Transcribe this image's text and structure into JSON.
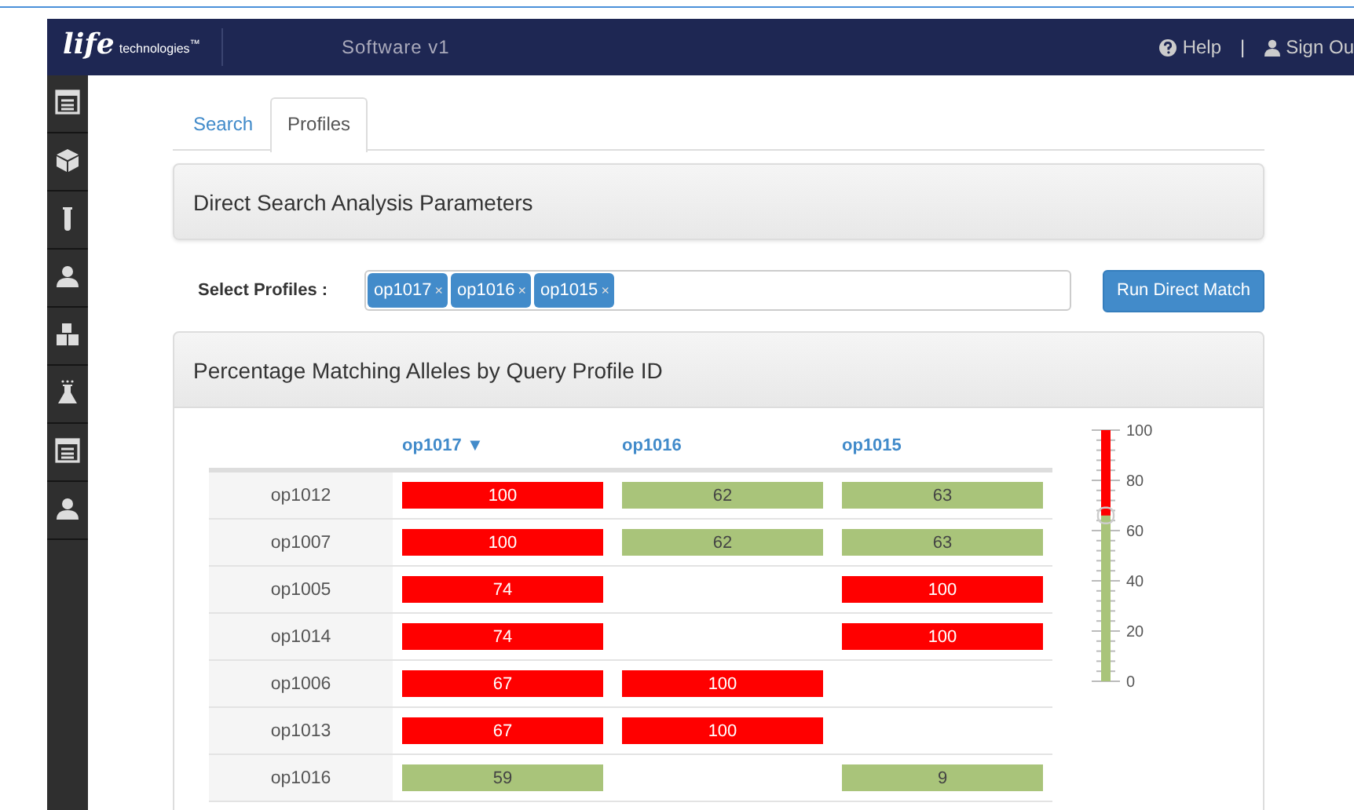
{
  "header": {
    "logo_mark": "life",
    "logo_text": "technologies",
    "logo_tm": "™",
    "title": "Software v1",
    "links": [
      {
        "label": "Help"
      },
      {
        "label": "Sign Ou"
      }
    ],
    "separator": "|"
  },
  "tabs": [
    {
      "label": "Search",
      "selected": false
    },
    {
      "label": "Profiles",
      "selected": true
    }
  ],
  "parameters_panel": {
    "title": "Direct Search Analysis Parameters"
  },
  "select_profiles": {
    "label": "Select Profiles :",
    "tags": [
      {
        "label": "op1017",
        "remove": "×"
      },
      {
        "label": "op1016",
        "remove": "×"
      },
      {
        "label": "op1015",
        "remove": "×"
      }
    ],
    "button": "Run Direct Match"
  },
  "results_panel": {
    "title": "Percentage Matching Alleles by Query Profile ID",
    "columns": [
      {
        "label": "op1017",
        "sort": "▼"
      },
      {
        "label": "op1016"
      },
      {
        "label": "op1015"
      }
    ],
    "rows": [
      {
        "id": "op1012",
        "cells": [
          {
            "value": "100",
            "color": "#ff0000"
          },
          {
            "value": "62",
            "color": "#a9c47a"
          },
          {
            "value": "63",
            "color": "#a9c47a"
          }
        ]
      },
      {
        "id": "op1007",
        "cells": [
          {
            "value": "100",
            "color": "#ff0000"
          },
          {
            "value": "62",
            "color": "#a9c47a"
          },
          {
            "value": "63",
            "color": "#a9c47a"
          }
        ]
      },
      {
        "id": "op1005",
        "cells": [
          {
            "value": "74",
            "color": "#ff0000"
          },
          null,
          {
            "value": "100",
            "color": "#ff0000"
          }
        ]
      },
      {
        "id": "op1014",
        "cells": [
          {
            "value": "74",
            "color": "#ff0000"
          },
          null,
          {
            "value": "100",
            "color": "#ff0000"
          }
        ]
      },
      {
        "id": "op1006",
        "cells": [
          {
            "value": "67",
            "color": "#ff0000"
          },
          {
            "value": "100",
            "color": "#ff0000"
          },
          null
        ]
      },
      {
        "id": "op1013",
        "cells": [
          {
            "value": "67",
            "color": "#ff0000"
          },
          {
            "value": "100",
            "color": "#ff0000"
          },
          null
        ]
      },
      {
        "id": "op1016",
        "cells": [
          {
            "value": "59",
            "color": "#a9c47a"
          },
          null,
          {
            "value": "9",
            "color": "#a9c47a"
          }
        ]
      }
    ],
    "threshold_slider": {
      "level": 0.66,
      "labels": [
        "100",
        "80",
        "60",
        "40",
        "20",
        "0"
      ]
    }
  }
}
